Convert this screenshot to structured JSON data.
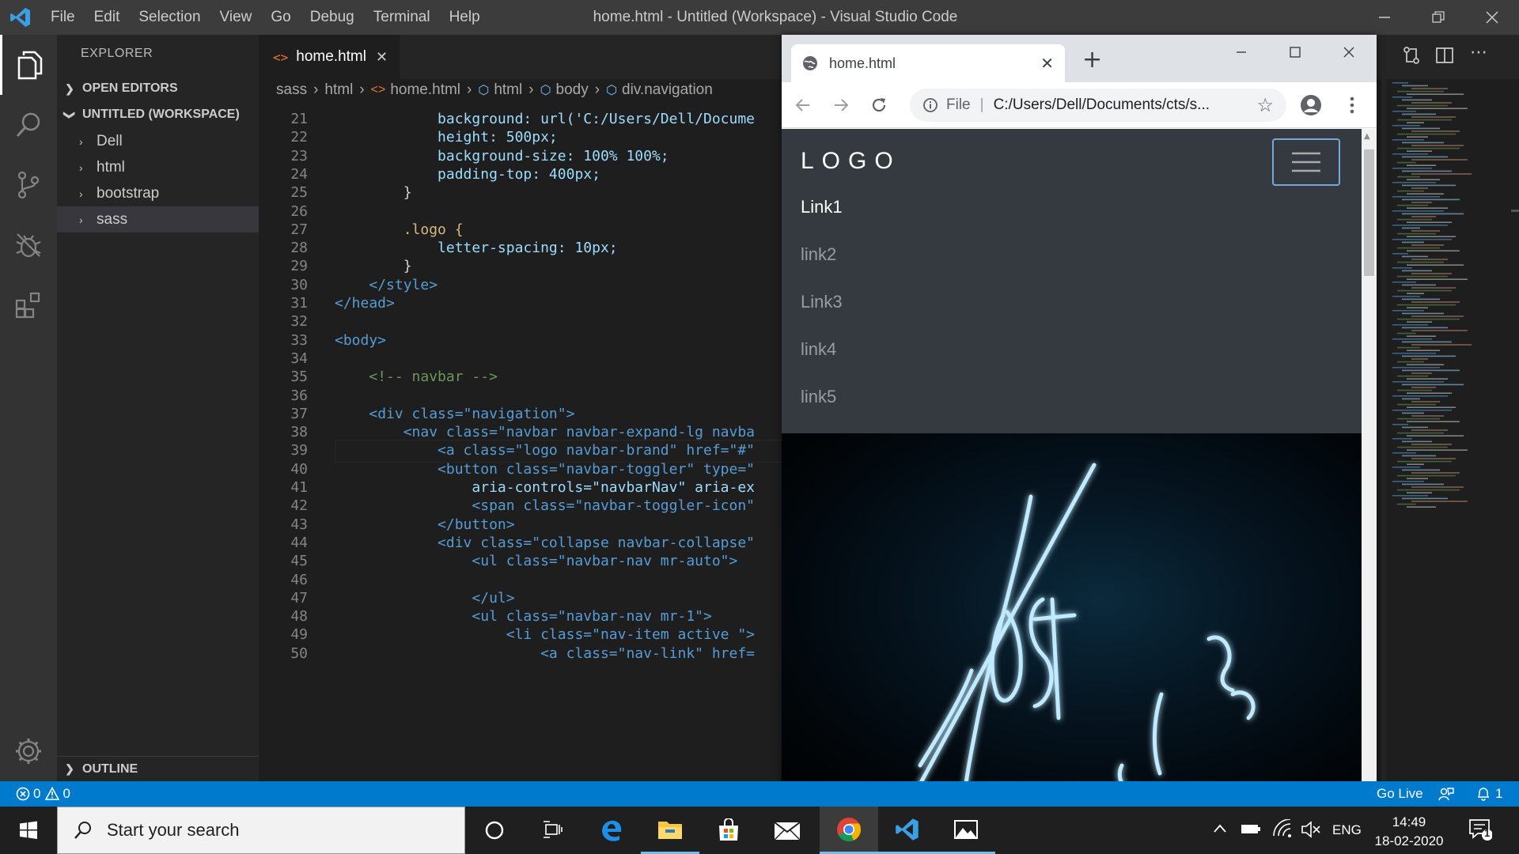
{
  "window": {
    "title": "home.html - Untitled (Workspace) - Visual Studio Code",
    "menu": [
      "File",
      "Edit",
      "Selection",
      "View",
      "Go",
      "Debug",
      "Terminal",
      "Help"
    ]
  },
  "sidebar": {
    "title": "EXPLORER",
    "open_editors": "OPEN EDITORS",
    "workspace": "UNTITLED (WORKSPACE)",
    "items": [
      {
        "label": "Dell"
      },
      {
        "label": "html"
      },
      {
        "label": "bootstrap"
      },
      {
        "label": "sass"
      }
    ],
    "outline": "OUTLINE"
  },
  "editor": {
    "tab_label": "home.html",
    "tab_icon": "<>",
    "breadcrumb": [
      "sass",
      "html",
      "home.html",
      "html",
      "body",
      "div.navigation"
    ],
    "lines": [
      {
        "n": "21",
        "t": "background: url('C:/Users/Dell/Docume"
      },
      {
        "n": "22",
        "t": "height: 500px;"
      },
      {
        "n": "23",
        "t": "background-size: 100% 100%;"
      },
      {
        "n": "24",
        "t": "padding-top: 400px;"
      },
      {
        "n": "25",
        "t": "}"
      },
      {
        "n": "26",
        "t": ""
      },
      {
        "n": "27",
        "t": ".logo {"
      },
      {
        "n": "28",
        "t": "letter-spacing: 10px;"
      },
      {
        "n": "29",
        "t": "}"
      },
      {
        "n": "30",
        "t": "</style>"
      },
      {
        "n": "31",
        "t": "</head>"
      },
      {
        "n": "32",
        "t": ""
      },
      {
        "n": "33",
        "t": "<body>"
      },
      {
        "n": "34",
        "t": ""
      },
      {
        "n": "35",
        "t": "<!-- navbar -->"
      },
      {
        "n": "36",
        "t": ""
      },
      {
        "n": "37",
        "t": "<div class=\"navigation\">"
      },
      {
        "n": "38",
        "t": "<nav class=\"navbar navbar-expand-lg navba"
      },
      {
        "n": "39",
        "t": "<a class=\"logo navbar-brand\" href=\"#\""
      },
      {
        "n": "40",
        "t": "<button class=\"navbar-toggler\" type=\""
      },
      {
        "n": "41",
        "t": "aria-controls=\"navbarNav\" aria-ex"
      },
      {
        "n": "42",
        "t": "<span class=\"navbar-toggler-icon\""
      },
      {
        "n": "43",
        "t": "</button>"
      },
      {
        "n": "44",
        "t": "<div class=\"collapse navbar-collapse\""
      },
      {
        "n": "45",
        "t": "<ul class=\"navbar-nav mr-auto\">"
      },
      {
        "n": "46",
        "t": ""
      },
      {
        "n": "47",
        "t": "</ul>"
      },
      {
        "n": "48",
        "t": "<ul class=\"navbar-nav mr-1\">"
      },
      {
        "n": "49",
        "t": "<li class=\"nav-item active \">"
      },
      {
        "n": "50",
        "t": "<a class=\"nav-link\" href="
      }
    ]
  },
  "browser": {
    "tab_title": "home.html",
    "new_tab": "+",
    "url_scheme": "File",
    "url": "C:/Users/Dell/Documents/cts/s...",
    "site": {
      "logo": "LOGO",
      "links": [
        "Link1",
        "link2",
        "Link3",
        "link4",
        "link5"
      ],
      "colors": {
        "navbar": "#343a40",
        "active_link": "#ffffff",
        "link": "#9a9da0"
      }
    }
  },
  "statusbar": {
    "errors": "0",
    "warnings": "0",
    "go_live": "Go Live",
    "notifications": "1",
    "color": "#007acc"
  },
  "taskbar": {
    "search_placeholder": "Start your search",
    "language": "ENG",
    "time": "14:49",
    "date": "18-02-2020",
    "action_center_count": "1",
    "apps": [
      "cortana-icon",
      "task-view-icon",
      "edge-icon",
      "file-explorer-icon",
      "store-icon",
      "mail-icon",
      "chrome-icon",
      "vscode-icon",
      "photos-icon"
    ]
  }
}
